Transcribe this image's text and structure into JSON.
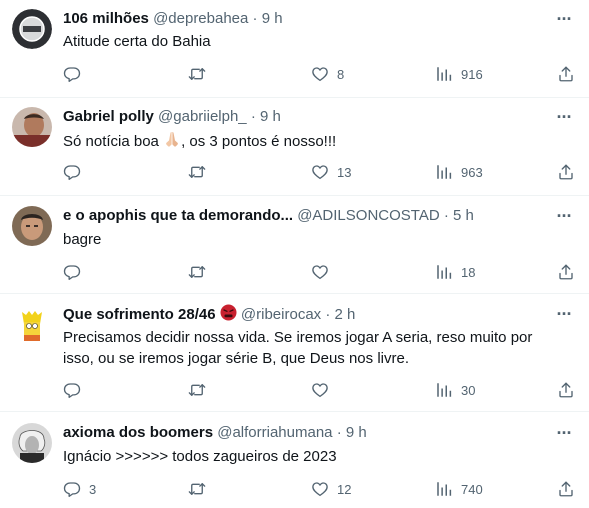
{
  "colors": {
    "text": "#0f1419",
    "muted": "#536471",
    "divider": "#eff3f4",
    "angry_emoji": "#c8212f"
  },
  "icons": {
    "more": "more-icon",
    "reply": "reply-icon",
    "retweet": "retweet-icon",
    "like": "heart-icon",
    "views": "analytics-icon",
    "share": "share-icon"
  },
  "more_label": "···",
  "tweets": [
    {
      "name": "106 milhões",
      "handle": "@deprebahea",
      "dot": "·",
      "time": "9 h",
      "text": [
        "Atitude certa do Bahia"
      ],
      "replies": "",
      "retweets": "",
      "likes": "8",
      "views": "916"
    },
    {
      "name": "Gabriel polly",
      "handle": "@gabriielph_",
      "dot": "·",
      "time": "9 h",
      "text_before": "Só notícia boa",
      "text_after": ", os 3 pontos é nosso!!!",
      "replies": "",
      "retweets": "",
      "likes": "13",
      "views": "963"
    },
    {
      "name": "e o apophis que ta demorando...",
      "handle": "@ADILSONCOSTAD",
      "dot": "·",
      "time": "5 h",
      "text": [
        "bagre"
      ],
      "replies": "",
      "retweets": "",
      "likes": "",
      "views": "18"
    },
    {
      "name": "Que sofrimento 28/46",
      "handle": "@ribeirocax",
      "dot": "·",
      "time": "2 h",
      "text": [
        "Precisamos decidir nossa vida. Se iremos jogar A seria, reso muito por",
        "isso, ou se iremos jogar série B, que Deus nos livre."
      ],
      "replies": "",
      "retweets": "",
      "likes": "",
      "views": "30"
    },
    {
      "name": "axioma dos boomers",
      "handle": "@alforriahumana",
      "dot": "·",
      "time": "9 h",
      "text": [
        "Ignácio >>>>>> todos zagueiros de 2023"
      ],
      "replies": "3",
      "retweets": "",
      "likes": "12",
      "views": "740"
    }
  ]
}
